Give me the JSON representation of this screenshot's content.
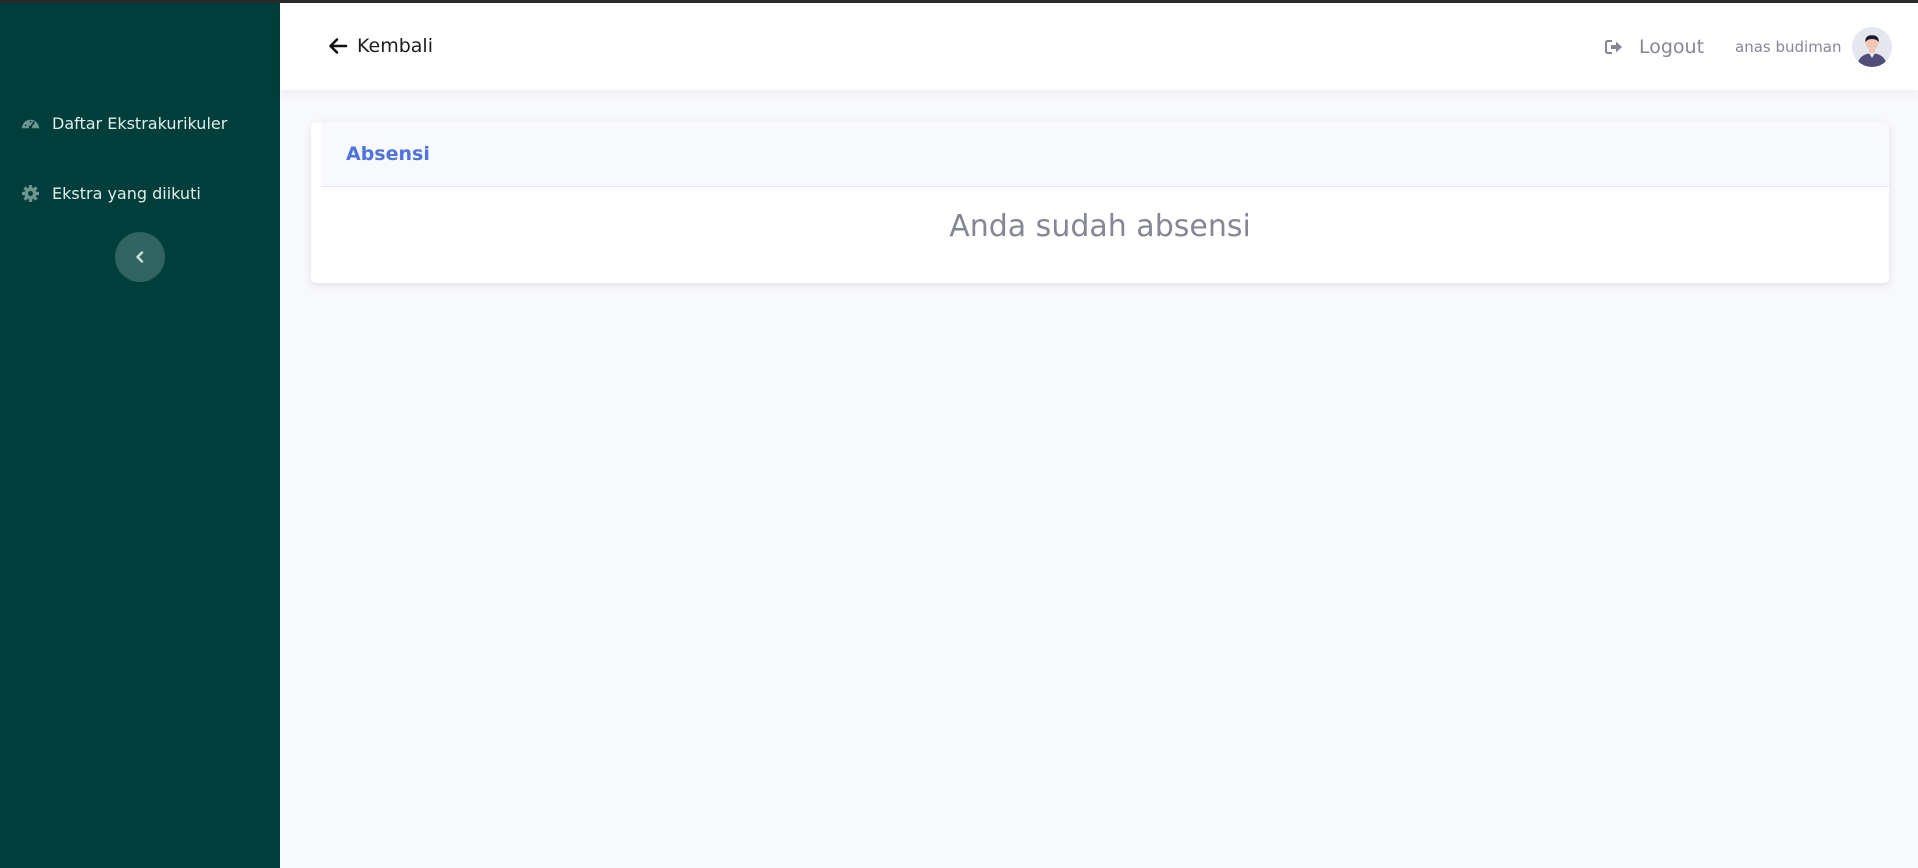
{
  "sidebar": {
    "items": [
      {
        "label": "Daftar Ekstrakurikuler",
        "icon": "dashboard-icon"
      },
      {
        "label": "Ekstra yang diikuti",
        "icon": "gear-icon"
      }
    ],
    "toggle_icon": "chevron-left-icon",
    "background": "#003e3b"
  },
  "topbar": {
    "back_label": "Kembali",
    "logout_label": "Logout",
    "user_name": "anas budiman"
  },
  "card": {
    "title": "Absensi",
    "message": "Anda sudah absensi"
  },
  "colors": {
    "accent": "#4e73df",
    "muted_text": "#858796",
    "page_bg": "#f8f9fc"
  }
}
